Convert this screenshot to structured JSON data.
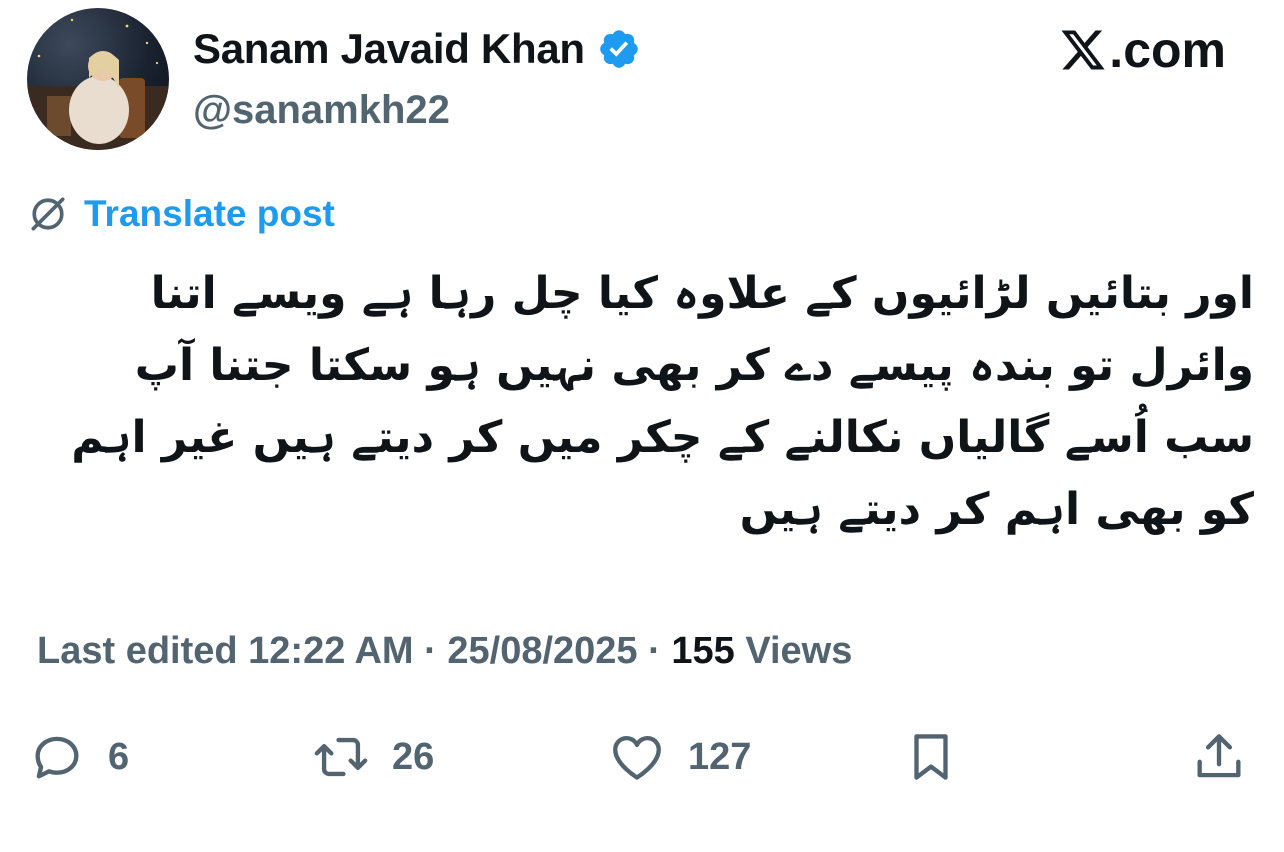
{
  "author": {
    "name": "Sanam Javaid Khan",
    "handle": "@sanamkh22",
    "verified_color": "#1d9bf0"
  },
  "brand": {
    "logo_text": ".com",
    "logo_icon": "x-logo-icon"
  },
  "translate": {
    "label": "Translate post",
    "icon": "globe-icon",
    "color": "#1d9bf0"
  },
  "post": {
    "text": "اور بتائیں لڑائیوں کے علاوہ کیا چل رہا ہے ویسے اتنا وائرل تو بندہ پیسے دے کر بھی نہیں ہو سکتا جتنا آپ سب اُسے گالیاں نکالنے کے چکر میں کر دیتے ہیں غیر اہم کو بھی اہم کر دیتے ہیں"
  },
  "meta": {
    "edited_label": "Last edited 12:22 AM",
    "separator": "·",
    "date": "25/08/2025",
    "views_count": "155",
    "views_label": "Views"
  },
  "actions": {
    "replies": "6",
    "reposts": "26",
    "likes": "127"
  },
  "colors": {
    "text": "#0f1419",
    "secondary": "#536471"
  }
}
